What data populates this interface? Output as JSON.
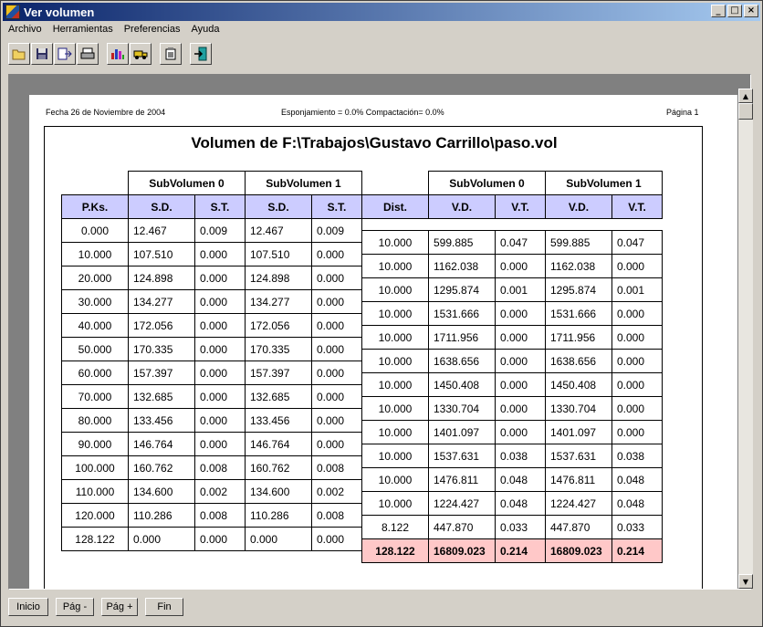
{
  "window": {
    "title": "Ver volumen",
    "buttons": {
      "minimize": "_",
      "maximize": "□",
      "close": "×"
    }
  },
  "menu": [
    "Archivo",
    "Herramientas",
    "Preferencias",
    "Ayuda"
  ],
  "toolbar_icons": [
    "open-folder-icon",
    "save-icon",
    "export-icon",
    "print-icon",
    "bar-chart-icon",
    "truck-icon",
    "clipboard-icon",
    "exit-icon"
  ],
  "header": {
    "fecha": "Fecha 26 de Noviembre de 2004",
    "esponjamiento": "Esponjamiento = 0.0% Compactación= 0.0%",
    "pagina": "Página 1"
  },
  "doc_title": "Volumen de F:\\Trabajos\\Gustavo Carrillo\\paso.vol",
  "left_table": {
    "group_headers": [
      "SubVolumen 0",
      "SubVolumen 1"
    ],
    "columns": [
      "P.Ks.",
      "S.D.",
      "S.T.",
      "S.D.",
      "S.T."
    ],
    "rows": [
      [
        "0.000",
        "12.467",
        "0.009",
        "12.467",
        "0.009"
      ],
      [
        "10.000",
        "107.510",
        "0.000",
        "107.510",
        "0.000"
      ],
      [
        "20.000",
        "124.898",
        "0.000",
        "124.898",
        "0.000"
      ],
      [
        "30.000",
        "134.277",
        "0.000",
        "134.277",
        "0.000"
      ],
      [
        "40.000",
        "172.056",
        "0.000",
        "172.056",
        "0.000"
      ],
      [
        "50.000",
        "170.335",
        "0.000",
        "170.335",
        "0.000"
      ],
      [
        "60.000",
        "157.397",
        "0.000",
        "157.397",
        "0.000"
      ],
      [
        "70.000",
        "132.685",
        "0.000",
        "132.685",
        "0.000"
      ],
      [
        "80.000",
        "133.456",
        "0.000",
        "133.456",
        "0.000"
      ],
      [
        "90.000",
        "146.764",
        "0.000",
        "146.764",
        "0.000"
      ],
      [
        "100.000",
        "160.762",
        "0.008",
        "160.762",
        "0.008"
      ],
      [
        "110.000",
        "134.600",
        "0.002",
        "134.600",
        "0.002"
      ],
      [
        "120.000",
        "110.286",
        "0.008",
        "110.286",
        "0.008"
      ],
      [
        "128.122",
        "0.000",
        "0.000",
        "0.000",
        "0.000"
      ]
    ]
  },
  "right_table": {
    "group_headers": [
      "SubVolumen 0",
      "SubVolumen 1"
    ],
    "columns": [
      "Dist.",
      "V.D.",
      "V.T.",
      "V.D.",
      "V.T."
    ],
    "rows": [
      [
        "10.000",
        "599.885",
        "0.047",
        "599.885",
        "0.047"
      ],
      [
        "10.000",
        "1162.038",
        "0.000",
        "1162.038",
        "0.000"
      ],
      [
        "10.000",
        "1295.874",
        "0.001",
        "1295.874",
        "0.001"
      ],
      [
        "10.000",
        "1531.666",
        "0.000",
        "1531.666",
        "0.000"
      ],
      [
        "10.000",
        "1711.956",
        "0.000",
        "1711.956",
        "0.000"
      ],
      [
        "10.000",
        "1638.656",
        "0.000",
        "1638.656",
        "0.000"
      ],
      [
        "10.000",
        "1450.408",
        "0.000",
        "1450.408",
        "0.000"
      ],
      [
        "10.000",
        "1330.704",
        "0.000",
        "1330.704",
        "0.000"
      ],
      [
        "10.000",
        "1401.097",
        "0.000",
        "1401.097",
        "0.000"
      ],
      [
        "10.000",
        "1537.631",
        "0.038",
        "1537.631",
        "0.038"
      ],
      [
        "10.000",
        "1476.811",
        "0.048",
        "1476.811",
        "0.048"
      ],
      [
        "10.000",
        "1224.427",
        "0.048",
        "1224.427",
        "0.048"
      ],
      [
        "8.122",
        "447.870",
        "0.033",
        "447.870",
        "0.033"
      ]
    ],
    "total": [
      "128.122",
      "16809.023",
      "0.214",
      "16809.023",
      "0.214"
    ]
  },
  "nav": [
    "Inicio",
    "Pág -",
    "Pág +",
    "Fin"
  ]
}
